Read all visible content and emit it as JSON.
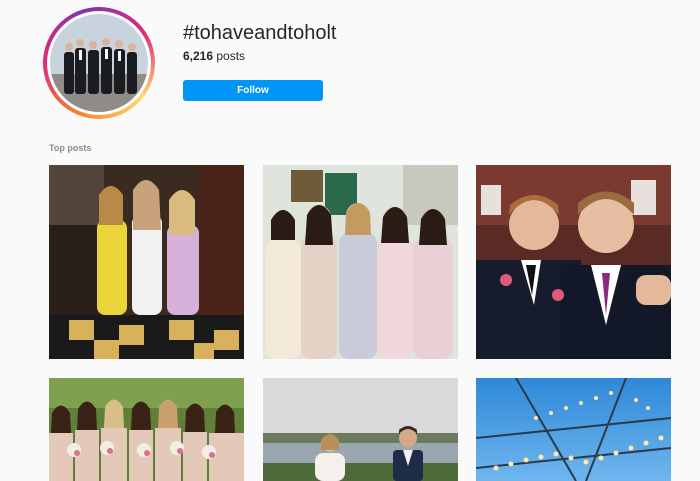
{
  "header": {
    "hashtag": "#tohaveandtoholt",
    "posts_count": "6,216",
    "posts_label": "posts",
    "follow_label": "Follow"
  },
  "sections": {
    "top_posts_label": "Top posts"
  },
  "posts": [
    {
      "subject": "three women in dresses at a bar"
    },
    {
      "subject": "five bridesmaids in pastel dresses"
    },
    {
      "subject": "two groomsmen selfie"
    },
    {
      "subject": "bridesmaids with bouquets outdoors"
    },
    {
      "subject": "couple by the water"
    },
    {
      "subject": "tent with string lights and blue sky"
    }
  ],
  "colors": {
    "follow_button": "#0095f6",
    "muted_text": "#8e8e8e",
    "background": "#fafafa"
  }
}
